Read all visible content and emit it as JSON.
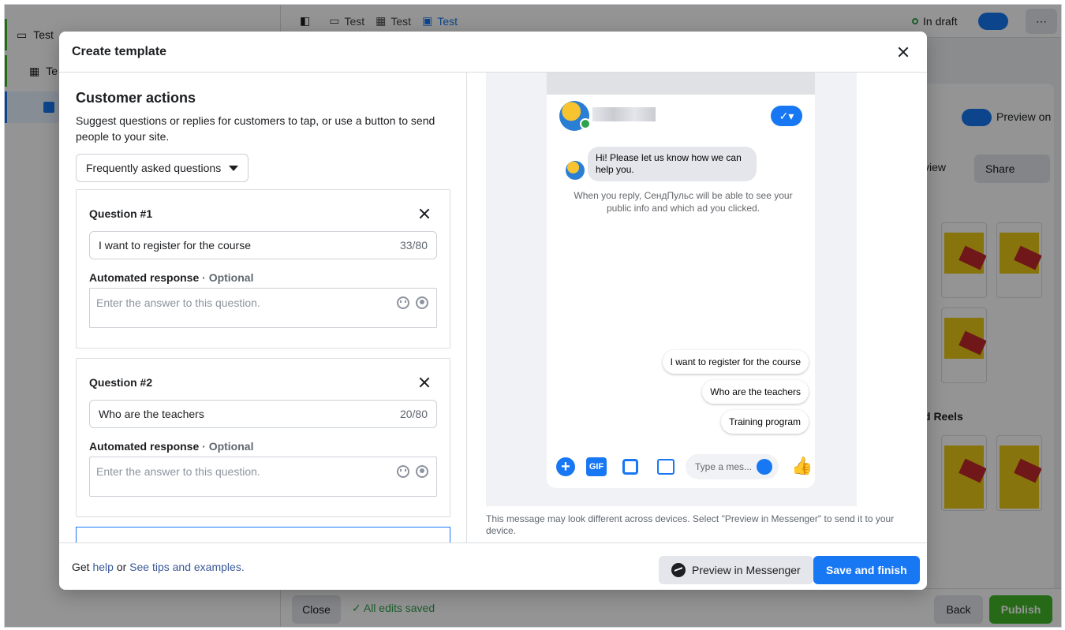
{
  "background": {
    "sidebar": {
      "items": [
        "Test",
        "Te"
      ]
    },
    "breadcrumb": [
      "Test",
      "Test",
      "Test"
    ],
    "status": "In draft",
    "preview_toggle_label": "Preview on",
    "share_label": "Share",
    "view_label": "view",
    "reels_label": "d Reels",
    "close_label": "Close",
    "saved_label": "All edits saved",
    "back_label": "Back",
    "publish_label": "Publish"
  },
  "modal": {
    "title": "Create template",
    "section": {
      "title": "Customer actions",
      "description": "Suggest questions or replies for customers to tap, or use a button to send people to your site.",
      "dropdown_value": "Frequently asked questions"
    },
    "questions": [
      {
        "heading": "Question #1",
        "value": "I want to register for the course",
        "count": "33/80",
        "response_label": "Automated response",
        "optional_label": " · Optional",
        "placeholder": "Enter the answer to this question."
      },
      {
        "heading": "Question #2",
        "value": "Who are the teachers",
        "count": "20/80",
        "response_label": "Automated response",
        "optional_label": " · Optional",
        "placeholder": "Enter the answer to this question."
      }
    ],
    "preview": {
      "greeting": "Hi! Please let us know how we can help you.",
      "note": "When you reply, СендПульс will be able to see your public info and which ad you clicked.",
      "replies": [
        "I want to register for the course",
        "Who are the teachers",
        "Training program"
      ],
      "gif_label": "GIF",
      "message_placeholder": "Type a mes...",
      "disclaimer": "This message may look different across devices. Select \"Preview in Messenger\" to send it to your device."
    },
    "footer": {
      "get_text": "Get ",
      "help_link": "help",
      "or_text": " or ",
      "tips_link": "See tips and examples.",
      "preview_button": "Preview in Messenger",
      "save_button": "Save and finish"
    }
  },
  "colors": {
    "accent": "#1877f2",
    "publish_green": "#42b72a",
    "draft_green": "#31a24c"
  }
}
